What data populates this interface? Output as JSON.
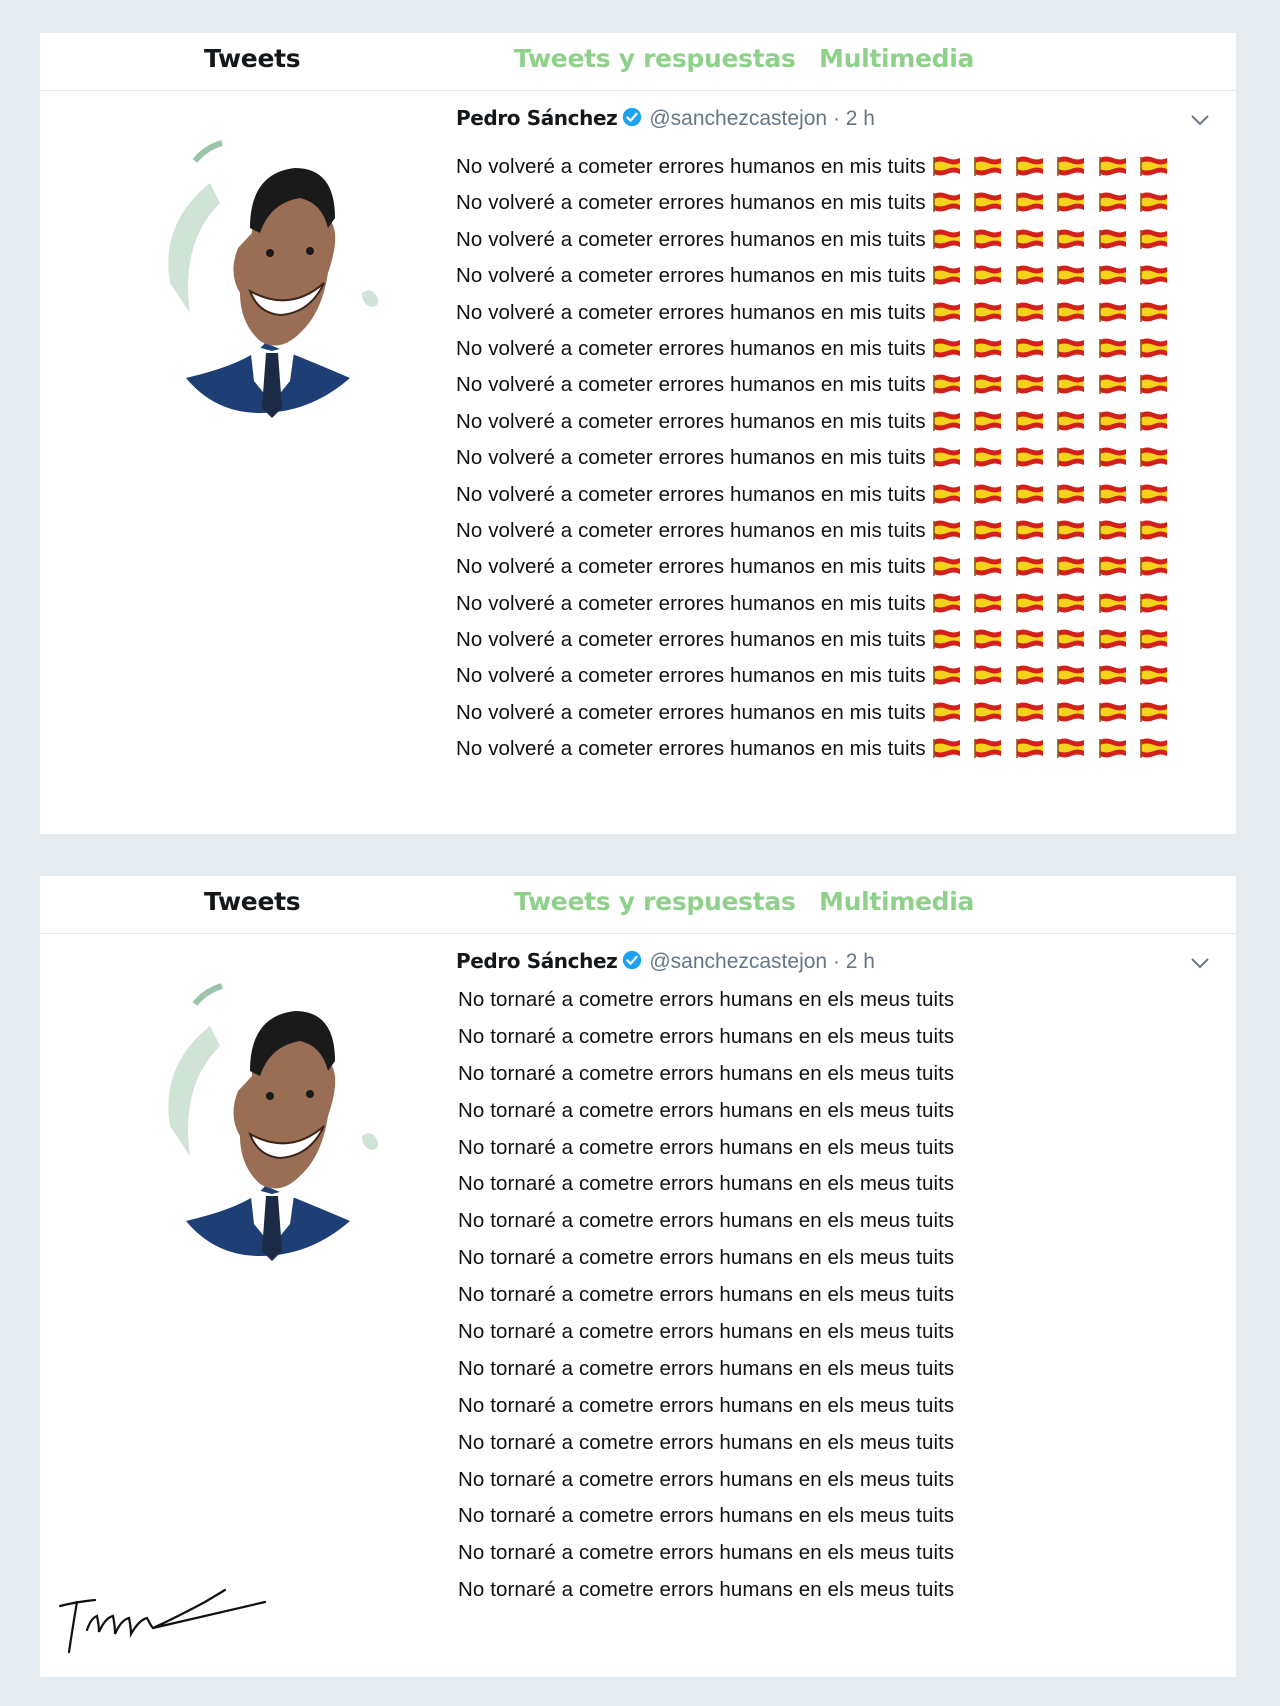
{
  "tabs": [
    "Tweets",
    "Tweets y respuestas",
    "Multimedia"
  ],
  "colors": {
    "active_tab": "#14171a",
    "inactive_tab": "#8fd18a",
    "verified": "#1da1f2",
    "meta": "#657786",
    "flag_red": "#d4201c",
    "flag_yellow": "#f5d21c"
  },
  "icons": [
    "avatar-caricature",
    "verified-icon",
    "chevron-down-icon",
    "spain-flag-emoji",
    "signature"
  ],
  "tweet_top": {
    "author": "Pedro Sánchez",
    "handle": "@sanchezcastejon",
    "separator": "·",
    "time": "2 h",
    "line_text": "No volveré a cometer errores humanos en mis tuits",
    "line_count": 17,
    "flags_per_line": 6
  },
  "tweet_bottom": {
    "author": "Pedro Sánchez",
    "handle": "@sanchezcastejon",
    "separator": "·",
    "time": "2 h",
    "line_text": "No tornaré a cometre errors humans en els meus tuits",
    "line_count": 17
  }
}
